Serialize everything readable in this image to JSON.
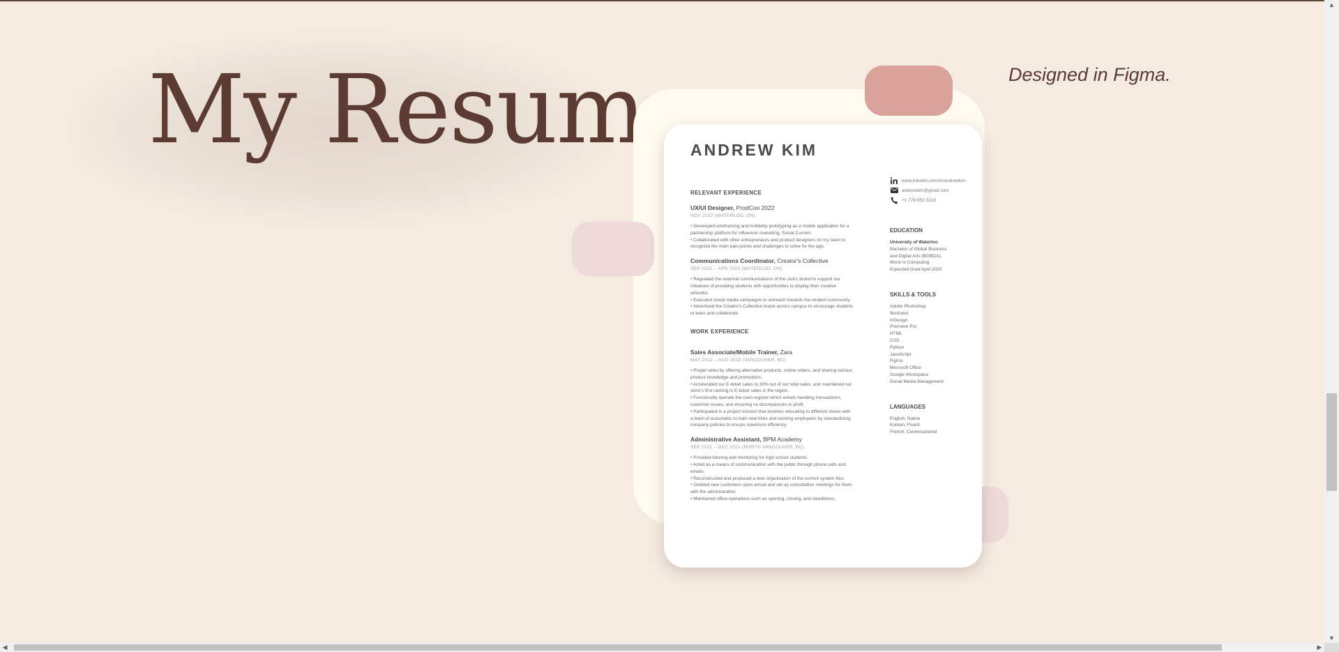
{
  "hero": {
    "title": "My Resume",
    "tagline": "Designed in Figma."
  },
  "resume": {
    "name": "ANDREW KIM",
    "relevant_heading": "RELEVANT EXPERIENCE",
    "relevant_jobs": [
      {
        "role": "UX/UI Designer,",
        "org": " ProdCon 2022",
        "date": "NOV 2022 (WATERLOO, ON)",
        "bullets": [
          "• Developed wireframing and hi-fidelity prototyping as a mobile application for a partnership platform for influencer marketing, Social Current.",
          "• Collaborated with other entrepreneurs and product designers on my team to recognize the main pain points and challenges to solve for the app."
        ]
      },
      {
        "role": "Communications Coordinator,",
        "org": " Creator's Collective",
        "date": "SEP 2021 – APR 2022 (WATERLOO, ON)",
        "bullets": [
          "• Regulated the external communications of the club's brand to support our initiatives of providing students with opportunities to display their creative artworks.",
          "• Executed social media campaigns to outreach towards the student community.",
          "• Advertised the Creator's Collective brand across campus to encourage students to learn and collaborate."
        ]
      }
    ],
    "work_heading": "WORK EXPERIENCE",
    "work_jobs": [
      {
        "role": "Sales Associate/Mobile Trainer,",
        "org": " Zara",
        "date": "MAY 2022 – AUG 2022 (VANCOUVER, BC)",
        "bullets": [
          "• Propel sales by offering alternative products, online orders, and sharing various product knowledge and promotions.",
          "• Accelerated our E-ticket sales to 30% out of our total sales, and maintained our store's first ranking in E-ticket sales in the region.",
          "• Functionally operate the cash register which entails handling transactions, customer issues, and ensuring no discrepancies in profit.",
          "• Participated in a project mission that involves relocating to different stores with a team of associates to train new hires and existing employees by standardizing company policies to ensure maximum efficiency."
        ]
      },
      {
        "role": "Administrative Assistant,",
        "org": " BPM Academy",
        "date": "SEP 2021 – DEC 2021 (NORTH VANCOUVER, BC)",
        "bullets": [
          "• Provided tutoring and mentoring for high school students.",
          "• Acted as a means of communication with the public through phone calls and emails.",
          "• Reconstructed and produced a new organization of the current system files.",
          "• Greeted new customers upon arrival and set up consultation meetings for them with the administration.",
          "• Maintained office operations such as opening, closing, and cleanliness."
        ]
      }
    ],
    "contact": {
      "linkedin": "www.linkedin.com/in/andrewkim",
      "email": "andrewkim@gmail.com",
      "phone": "+1 778 953 3218",
      "linkedin_icon": "linkedin-icon",
      "email_icon": "mail-icon",
      "phone_icon": "phone-icon"
    },
    "education": {
      "heading": "EDUCATION",
      "school": "University of Waterloo",
      "degree_line1": "Bachelor of Global Business",
      "degree_line2": "and Digital Arts (BGBDA),",
      "minor": "Minor in Computing",
      "grad": "Expected Grad April 2025"
    },
    "skills": {
      "heading": "SKILLS & TOOLS",
      "items": [
        "Adobe Photoshop",
        "Illustrator",
        "InDesign",
        "Premiere Pro",
        "HTML",
        "CSS",
        "Python",
        "JavaScript",
        "Figma",
        "Microsoft Office",
        "Google Workspace",
        "Social Media Management"
      ]
    },
    "languages": {
      "heading": "LANGUAGES",
      "items": [
        "English, Native",
        "Korean, Fluent",
        "French, Conversational"
      ]
    }
  },
  "scrollbar": {
    "up_arrow": "▲",
    "down_arrow": "▼",
    "left_arrow": "◀",
    "right_arrow": "▶"
  },
  "colors": {
    "background": "#f5ebe1",
    "title_brown": "#5c3b32",
    "blob_pink": "#d9a39a",
    "blob_light_pink": "#eedad8",
    "blob_cream": "#fffbf0"
  }
}
